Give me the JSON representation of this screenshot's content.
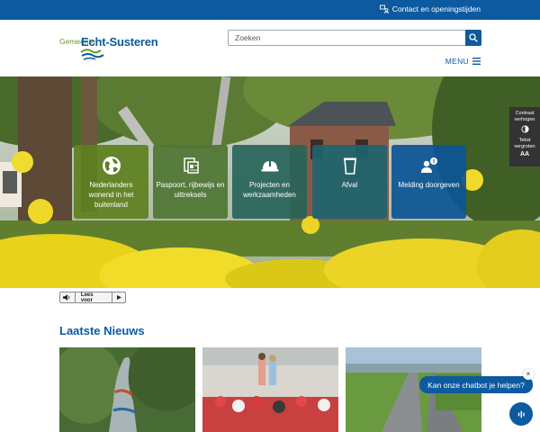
{
  "topbar": {
    "contact_label": "Contact en openingstijden",
    "icon": "contact-icon"
  },
  "header": {
    "logo": {
      "prefix": "Gemeente",
      "name": "Echt-Susteren"
    },
    "search": {
      "placeholder": "Zoeken",
      "button_icon": "search-icon"
    },
    "menu_label": "MENU"
  },
  "tiles": [
    {
      "label": "Nederlanders wonend in het buitenland",
      "icon": "globe-icon"
    },
    {
      "label": "Paspoort, rijbewijs en uittreksels",
      "icon": "id-card-icon"
    },
    {
      "label": "Projecten en werkzaamheden",
      "icon": "hard-hat-icon"
    },
    {
      "label": "Afval",
      "icon": "trash-bin-icon"
    },
    {
      "label": "Melding doorgeven",
      "icon": "report-icon"
    }
  ],
  "accessibility": {
    "contrast_label": "Contrast verhogen",
    "text_label": "Tekst vergroten",
    "text_symbol": "AA"
  },
  "read_aloud": {
    "label": "Lees voor"
  },
  "news": {
    "title": "Laatste Nieuws"
  },
  "chatbot": {
    "prompt": "Kan onze chatbot je helpen?",
    "close": "×"
  },
  "colors": {
    "primary": "#0d5aa0",
    "green": "#5e801e",
    "teal": "#28645a"
  }
}
